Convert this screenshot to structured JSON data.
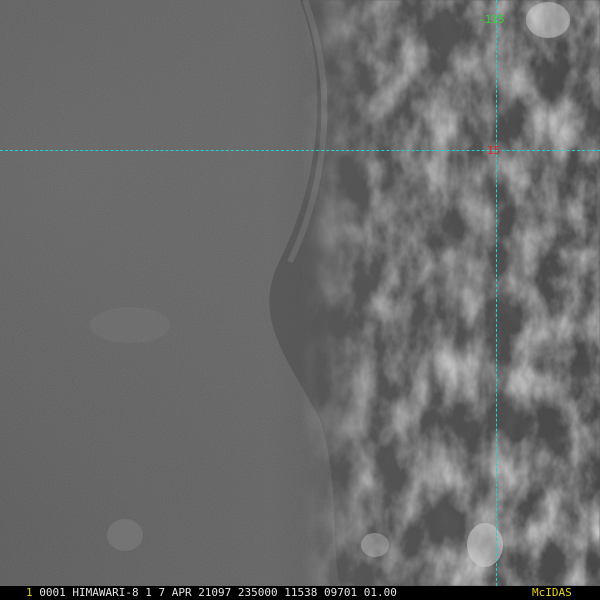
{
  "overlay": {
    "longitude_label": "-115",
    "latitude_label": "15",
    "grid_color": "#22d0d0",
    "longitude_label_color": "#2bdc2b",
    "latitude_label_color": "#e02020"
  },
  "status_bar": {
    "frame_number": "1",
    "info_text": " 0001 HIMAWARI-8  1  7 APR 21097 235000 11538 09701 01.00",
    "logo_text": "McIDAS",
    "highlight_color": "#e8d21a"
  }
}
